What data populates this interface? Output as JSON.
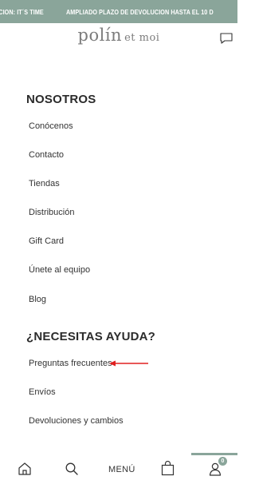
{
  "promo": {
    "items": [
      "CCION: IT´S TIME",
      "AMPLIADO PLAZO DE DEVOLUCION HASTA EL 10 D"
    ]
  },
  "header": {
    "logo_main": "polín",
    "logo_sub": "et moi"
  },
  "menu": {
    "sections": [
      {
        "title": "NOSOTROS",
        "links": [
          "Conócenos",
          "Contacto",
          "Tiendas",
          "Distribución",
          "Gift Card",
          "Únete al equipo",
          "Blog"
        ]
      },
      {
        "title": "¿NECESITAS AYUDA?",
        "links": [
          "Preguntas frecuentes",
          "Envíos",
          "Devoluciones y cambios"
        ]
      }
    ]
  },
  "bottom_nav": {
    "menu_label": "MENÚ",
    "cart_count": "0",
    "accent_color": "#8aa59a"
  },
  "colors": {
    "brand": "#8aa59a",
    "annotation_arrow": "#e02020"
  }
}
